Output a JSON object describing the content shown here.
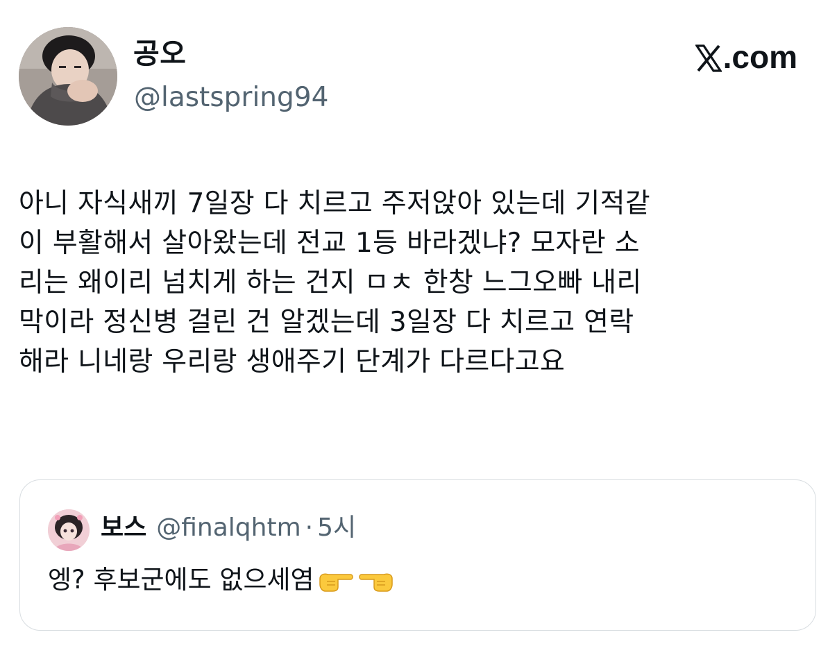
{
  "tweet": {
    "author": {
      "display_name": "공오",
      "handle": "@lastspring94"
    },
    "brand": ".com",
    "brand_icon": "x-logo-icon",
    "text": "아니 자식새끼 7일장 다 치르고 주저앉아 있는데 기적같\n이 부활해서 살아왔는데 전교 1등 바라겠냐? 모자란 소\n리는 왜이리 넘치게 하는 건지 ㅁㅊ 한창 느그오빠 내리\n막이라 정신병 걸린 건 알겠는데 3일장 다 치르고 연락\n해라 니네랑 우리랑 생애주기 단계가 다르다고요"
  },
  "quoted_tweet": {
    "display_name": "보스",
    "handle": "@finalqhtm",
    "separator": "·",
    "time": "5시",
    "text": "엥? 후보군에도 없으세염",
    "emoji": [
      "backhand-index-pointing-right",
      "backhand-index-pointing-left"
    ]
  },
  "colors": {
    "text": "#0f1419",
    "secondary": "#536471",
    "border": "#d8dde1",
    "background": "#ffffff"
  }
}
